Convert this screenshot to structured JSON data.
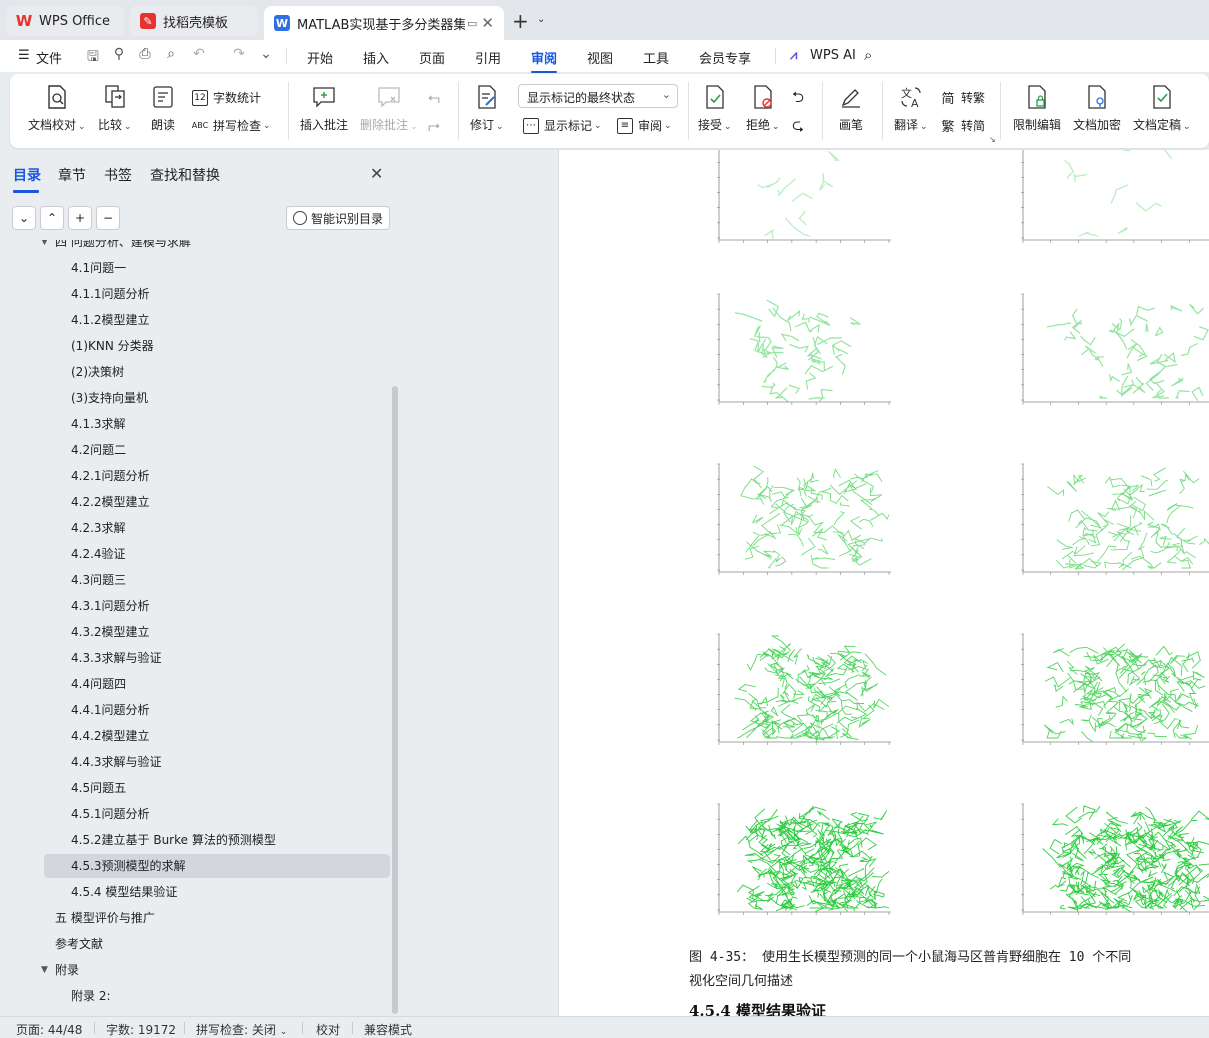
{
  "tabs": [
    {
      "label": "WPS Office",
      "icon": "wps-logo-icon"
    },
    {
      "label": "找稻壳模板",
      "icon": "docer-icon"
    },
    {
      "label": "MATLAB实现基于多分类器集",
      "icon": "writer-doc-icon"
    }
  ],
  "menu": {
    "file": "文件",
    "items": [
      "开始",
      "插入",
      "页面",
      "引用",
      "审阅",
      "视图",
      "工具",
      "会员专享"
    ],
    "active": "审阅",
    "wps_ai": "WPS AI"
  },
  "ribbon": {
    "doc_proofread": "文档校对",
    "compare": "比较",
    "read_aloud": "朗读",
    "word_count": "字数统计",
    "spell_check": "拼写检查",
    "insert_comment": "插入批注",
    "delete_comment": "删除批注",
    "track_changes": "修订",
    "markup_view": "显示标记的最终状态",
    "show_markup": "显示标记",
    "review_pane": "审阅",
    "accept": "接受",
    "reject": "拒绝",
    "ink": "画笔",
    "translate": "翻译",
    "to_traditional": "转繁",
    "to_simplified": "转简",
    "restrict_edit": "限制编辑",
    "encrypt": "文档加密",
    "finalize": "文档定稿"
  },
  "sidebar": {
    "tabs": [
      "目录",
      "章节",
      "书签",
      "查找和替换"
    ],
    "smart_toc": "智能识别目录",
    "toc": [
      {
        "label": "四 问题分析、建模与求解",
        "level": 1,
        "expand": true,
        "partial": true
      },
      {
        "label": "4.1问题一",
        "level": 2
      },
      {
        "label": "4.1.1问题分析",
        "level": 2
      },
      {
        "label": "4.1.2模型建立",
        "level": 2
      },
      {
        "label": "(1)KNN 分类器",
        "level": 2
      },
      {
        "label": "(2)决策树",
        "level": 2
      },
      {
        "label": "(3)支持向量机",
        "level": 2
      },
      {
        "label": "4.1.3求解",
        "level": 2
      },
      {
        "label": "4.2问题二",
        "level": 2
      },
      {
        "label": "4.2.1问题分析",
        "level": 2
      },
      {
        "label": "4.2.2模型建立",
        "level": 2
      },
      {
        "label": "4.2.3求解",
        "level": 2
      },
      {
        "label": "4.2.4验证",
        "level": 2
      },
      {
        "label": "4.3问题三",
        "level": 2
      },
      {
        "label": "4.3.1问题分析",
        "level": 2
      },
      {
        "label": "4.3.2模型建立",
        "level": 2
      },
      {
        "label": "4.3.3求解与验证",
        "level": 2
      },
      {
        "label": "4.4问题四",
        "level": 2
      },
      {
        "label": "4.4.1问题分析",
        "level": 2
      },
      {
        "label": "4.4.2模型建立",
        "level": 2
      },
      {
        "label": "4.4.3求解与验证",
        "level": 2
      },
      {
        "label": "4.5问题五",
        "level": 2
      },
      {
        "label": "4.5.1问题分析",
        "level": 2
      },
      {
        "label": "4.5.2建立基于 Burke 算法的预测模型",
        "level": 2
      },
      {
        "label": "4.5.3预测模型的求解",
        "level": 2,
        "selected": true
      },
      {
        "label": "4.5.4 模型结果验证",
        "level": 2
      },
      {
        "label": "五 模型评价与推广",
        "level": 1
      },
      {
        "label": "参考文献",
        "level": 1
      },
      {
        "label": "附录",
        "level": 1,
        "expand": true
      },
      {
        "label": "附录 2:",
        "level": 2
      }
    ]
  },
  "document": {
    "caption_line1": "图 4-35： 使用生长模型预测的同一个小鼠海马区普肯野细胞在 10 个不同",
    "caption_line2": "视化空间几何描述",
    "heading": "4.5.4 模型结果验证"
  },
  "status": {
    "page": "页面: 44/48",
    "word_count": "字数: 19172",
    "spell": "拼写检查: 关闭",
    "proofread": "校对",
    "compat": "兼容模式"
  },
  "colors": {
    "accent": "#1a56db",
    "plot_green": "#2ecc40"
  }
}
